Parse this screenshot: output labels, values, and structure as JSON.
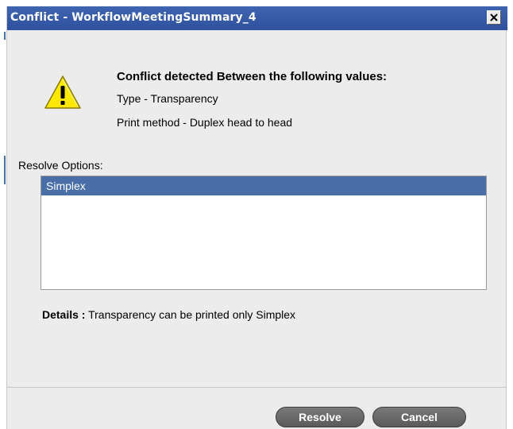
{
  "window": {
    "title": "Conflict - WorkflowMeetingSummary_4",
    "close_symbol": "×"
  },
  "icons": {
    "warning": "warning-icon",
    "close": "close-icon"
  },
  "conflict": {
    "heading": "Conflict detected Between the following values:",
    "line1": "Type - Transparency",
    "line2": "Print method - Duplex head to head"
  },
  "resolve": {
    "label": "Resolve Options:",
    "options": [
      "Simplex"
    ],
    "selected": "Simplex"
  },
  "details": {
    "label": "Details :",
    "text": "Transparency can be printed only Simplex"
  },
  "buttons": {
    "resolve": "Resolve",
    "cancel": "Cancel"
  },
  "colors": {
    "titlebar": "#3f64b0",
    "selection": "#4a6ea8",
    "dialog_bg": "#ececec",
    "button": "#6a6a6a",
    "warning_fill": "#ffe800"
  }
}
